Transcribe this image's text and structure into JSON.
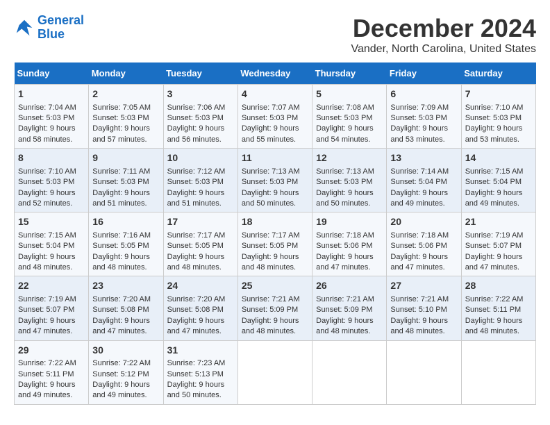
{
  "logo": {
    "line1": "General",
    "line2": "Blue"
  },
  "title": "December 2024",
  "subtitle": "Vander, North Carolina, United States",
  "days_of_week": [
    "Sunday",
    "Monday",
    "Tuesday",
    "Wednesday",
    "Thursday",
    "Friday",
    "Saturday"
  ],
  "weeks": [
    [
      {
        "day": "1",
        "data": "Sunrise: 7:04 AM\nSunset: 5:03 PM\nDaylight: 9 hours and 58 minutes."
      },
      {
        "day": "2",
        "data": "Sunrise: 7:05 AM\nSunset: 5:03 PM\nDaylight: 9 hours and 57 minutes."
      },
      {
        "day": "3",
        "data": "Sunrise: 7:06 AM\nSunset: 5:03 PM\nDaylight: 9 hours and 56 minutes."
      },
      {
        "day": "4",
        "data": "Sunrise: 7:07 AM\nSunset: 5:03 PM\nDaylight: 9 hours and 55 minutes."
      },
      {
        "day": "5",
        "data": "Sunrise: 7:08 AM\nSunset: 5:03 PM\nDaylight: 9 hours and 54 minutes."
      },
      {
        "day": "6",
        "data": "Sunrise: 7:09 AM\nSunset: 5:03 PM\nDaylight: 9 hours and 53 minutes."
      },
      {
        "day": "7",
        "data": "Sunrise: 7:10 AM\nSunset: 5:03 PM\nDaylight: 9 hours and 53 minutes."
      }
    ],
    [
      {
        "day": "8",
        "data": "Sunrise: 7:10 AM\nSunset: 5:03 PM\nDaylight: 9 hours and 52 minutes."
      },
      {
        "day": "9",
        "data": "Sunrise: 7:11 AM\nSunset: 5:03 PM\nDaylight: 9 hours and 51 minutes."
      },
      {
        "day": "10",
        "data": "Sunrise: 7:12 AM\nSunset: 5:03 PM\nDaylight: 9 hours and 51 minutes."
      },
      {
        "day": "11",
        "data": "Sunrise: 7:13 AM\nSunset: 5:03 PM\nDaylight: 9 hours and 50 minutes."
      },
      {
        "day": "12",
        "data": "Sunrise: 7:13 AM\nSunset: 5:03 PM\nDaylight: 9 hours and 50 minutes."
      },
      {
        "day": "13",
        "data": "Sunrise: 7:14 AM\nSunset: 5:04 PM\nDaylight: 9 hours and 49 minutes."
      },
      {
        "day": "14",
        "data": "Sunrise: 7:15 AM\nSunset: 5:04 PM\nDaylight: 9 hours and 49 minutes."
      }
    ],
    [
      {
        "day": "15",
        "data": "Sunrise: 7:15 AM\nSunset: 5:04 PM\nDaylight: 9 hours and 48 minutes."
      },
      {
        "day": "16",
        "data": "Sunrise: 7:16 AM\nSunset: 5:05 PM\nDaylight: 9 hours and 48 minutes."
      },
      {
        "day": "17",
        "data": "Sunrise: 7:17 AM\nSunset: 5:05 PM\nDaylight: 9 hours and 48 minutes."
      },
      {
        "day": "18",
        "data": "Sunrise: 7:17 AM\nSunset: 5:05 PM\nDaylight: 9 hours and 48 minutes."
      },
      {
        "day": "19",
        "data": "Sunrise: 7:18 AM\nSunset: 5:06 PM\nDaylight: 9 hours and 47 minutes."
      },
      {
        "day": "20",
        "data": "Sunrise: 7:18 AM\nSunset: 5:06 PM\nDaylight: 9 hours and 47 minutes."
      },
      {
        "day": "21",
        "data": "Sunrise: 7:19 AM\nSunset: 5:07 PM\nDaylight: 9 hours and 47 minutes."
      }
    ],
    [
      {
        "day": "22",
        "data": "Sunrise: 7:19 AM\nSunset: 5:07 PM\nDaylight: 9 hours and 47 minutes."
      },
      {
        "day": "23",
        "data": "Sunrise: 7:20 AM\nSunset: 5:08 PM\nDaylight: 9 hours and 47 minutes."
      },
      {
        "day": "24",
        "data": "Sunrise: 7:20 AM\nSunset: 5:08 PM\nDaylight: 9 hours and 47 minutes."
      },
      {
        "day": "25",
        "data": "Sunrise: 7:21 AM\nSunset: 5:09 PM\nDaylight: 9 hours and 48 minutes."
      },
      {
        "day": "26",
        "data": "Sunrise: 7:21 AM\nSunset: 5:09 PM\nDaylight: 9 hours and 48 minutes."
      },
      {
        "day": "27",
        "data": "Sunrise: 7:21 AM\nSunset: 5:10 PM\nDaylight: 9 hours and 48 minutes."
      },
      {
        "day": "28",
        "data": "Sunrise: 7:22 AM\nSunset: 5:11 PM\nDaylight: 9 hours and 48 minutes."
      }
    ],
    [
      {
        "day": "29",
        "data": "Sunrise: 7:22 AM\nSunset: 5:11 PM\nDaylight: 9 hours and 49 minutes."
      },
      {
        "day": "30",
        "data": "Sunrise: 7:22 AM\nSunset: 5:12 PM\nDaylight: 9 hours and 49 minutes."
      },
      {
        "day": "31",
        "data": "Sunrise: 7:23 AM\nSunset: 5:13 PM\nDaylight: 9 hours and 50 minutes."
      },
      {
        "day": "",
        "data": ""
      },
      {
        "day": "",
        "data": ""
      },
      {
        "day": "",
        "data": ""
      },
      {
        "day": "",
        "data": ""
      }
    ]
  ]
}
